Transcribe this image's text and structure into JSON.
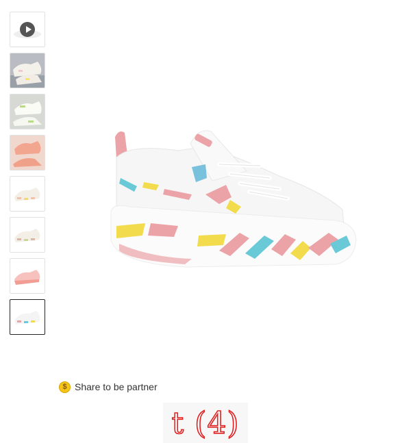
{
  "share": {
    "label": "Share to be partner",
    "icon": "coin-icon"
  },
  "watermark": {
    "text": "t (4)"
  },
  "gallery": {
    "thumbnails": [
      {
        "name": "video",
        "kind": "video",
        "icon": "play-icon"
      },
      {
        "name": "photo-1",
        "kind": "image"
      },
      {
        "name": "photo-2",
        "kind": "image"
      },
      {
        "name": "photo-3",
        "kind": "image"
      },
      {
        "name": "photo-4",
        "kind": "image"
      },
      {
        "name": "photo-5",
        "kind": "image"
      },
      {
        "name": "photo-6",
        "kind": "image"
      },
      {
        "name": "photo-7",
        "kind": "image",
        "selected": true
      }
    ]
  },
  "colors": {
    "accent_pink": "#eba3a7",
    "accent_yellow": "#f2dc4e",
    "accent_blue": "#69c9d6",
    "watermark_red": "#e02020"
  }
}
